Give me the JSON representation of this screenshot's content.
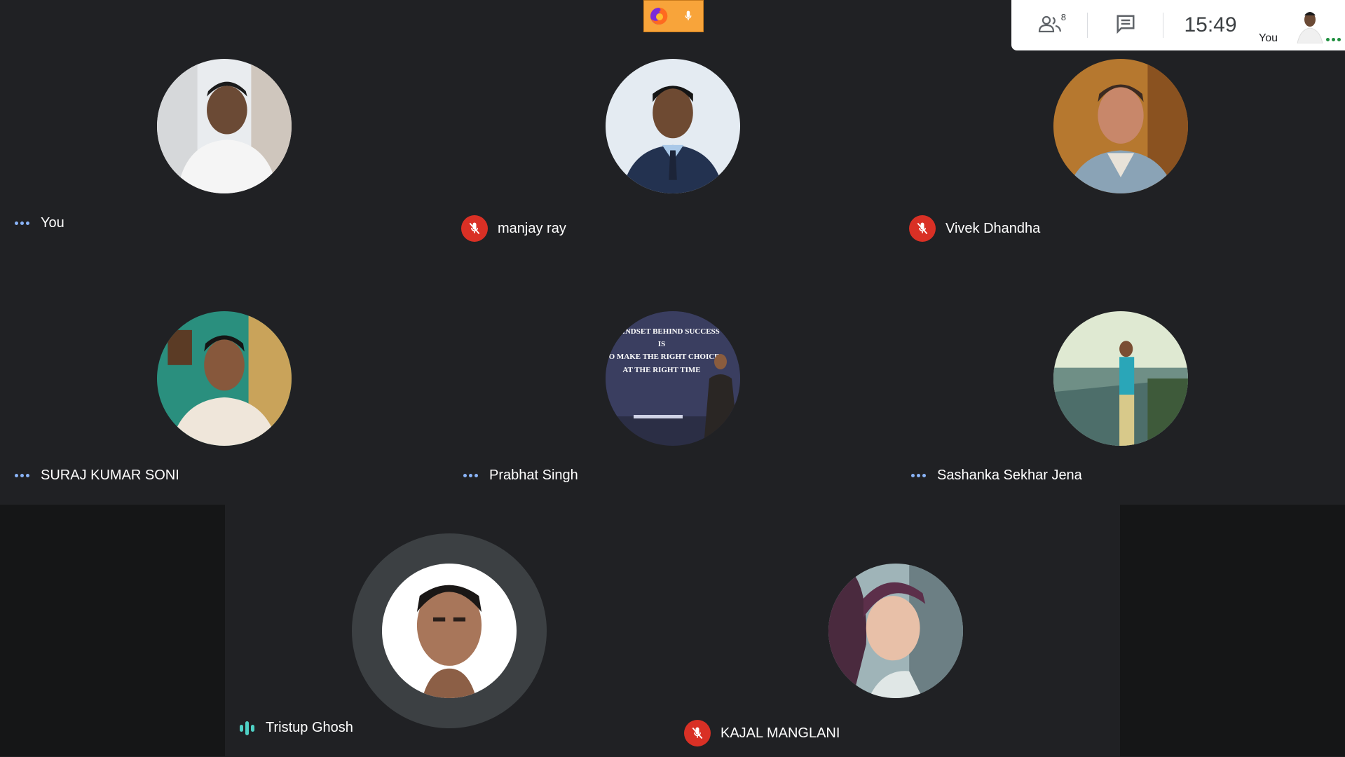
{
  "meeting": {
    "participant_count": "8",
    "time": "15:49",
    "self_label": "You"
  },
  "participants": [
    {
      "name": "You",
      "status": "more-options",
      "muted": false
    },
    {
      "name": "manjay ray",
      "status": "muted",
      "muted": true
    },
    {
      "name": "Vivek Dhandha",
      "status": "muted",
      "muted": true
    },
    {
      "name": "SURAJ KUMAR SONI",
      "status": "more-options",
      "muted": false
    },
    {
      "name": "Prabhat Singh",
      "status": "more-options",
      "muted": false
    },
    {
      "name": "Sashanka Sekhar Jena",
      "status": "more-options",
      "muted": false
    },
    {
      "name": "Tristup Ghosh",
      "status": "speaking",
      "muted": false
    },
    {
      "name": "KAJAL MANGLANI",
      "status": "muted",
      "muted": true
    }
  ],
  "slide_text": {
    "line1": "MINDSET BEHIND SUCCESS",
    "line2": "IS",
    "line3": "TO MAKE THE RIGHT CHOICE",
    "line4": "AT THE RIGHT TIME"
  },
  "icons": {
    "people": "people-icon",
    "chat": "chat-icon",
    "mute": "mic-off-icon",
    "more": "more-options-icon",
    "speaking": "audio-level-icon",
    "firefox": "firefox-icon",
    "microphone": "microphone-icon"
  },
  "colors": {
    "background": "#202124",
    "mute_red": "#d93025",
    "dots_blue": "#8ab4f8",
    "speaking_teal": "#4fd1c5",
    "indicator_orange": "#f8a43a"
  }
}
